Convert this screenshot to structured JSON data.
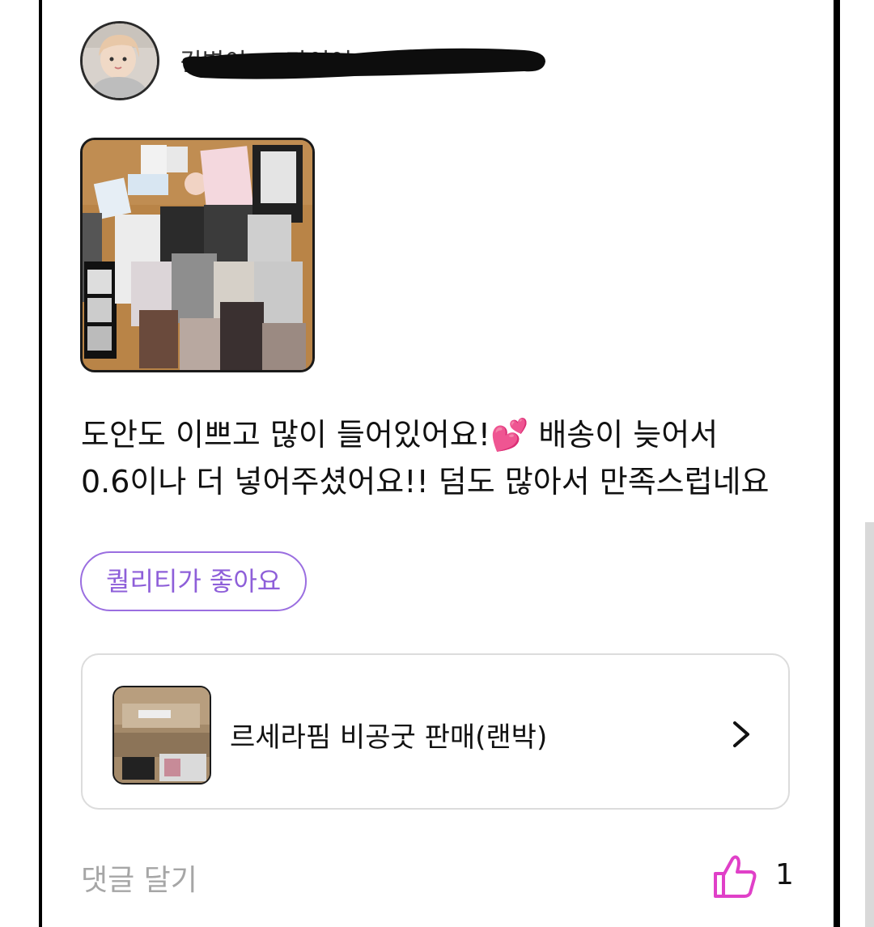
{
  "review": {
    "author": {
      "name": "김별이 ··· 다이어",
      "avatar_icon": "profile-avatar"
    },
    "photo_icon": "photocard-collection-photo",
    "text_lines": [
      "도안도 이쁘고 많이 들어있어요!💕 배송이 늦어서",
      "0.6이나 더 넣어주셨어요!! 덤도 많아서 만족스럽네요"
    ],
    "tag": "퀄리티가 좋아요"
  },
  "product": {
    "title": "르세라핌 비공굿 판매(랜박)",
    "thumb_icon": "product-thumbnail",
    "chevron_icon": "chevron-right-icon"
  },
  "footer": {
    "comment_label": "댓글 달기",
    "like_icon": "thumbs-up-icon",
    "like_count": "1"
  },
  "colors": {
    "accent_purple": "#9a6ee0",
    "like_pink": "#e040c8",
    "muted_gray": "#a6a6a6",
    "card_border": "#dcdcdc"
  }
}
